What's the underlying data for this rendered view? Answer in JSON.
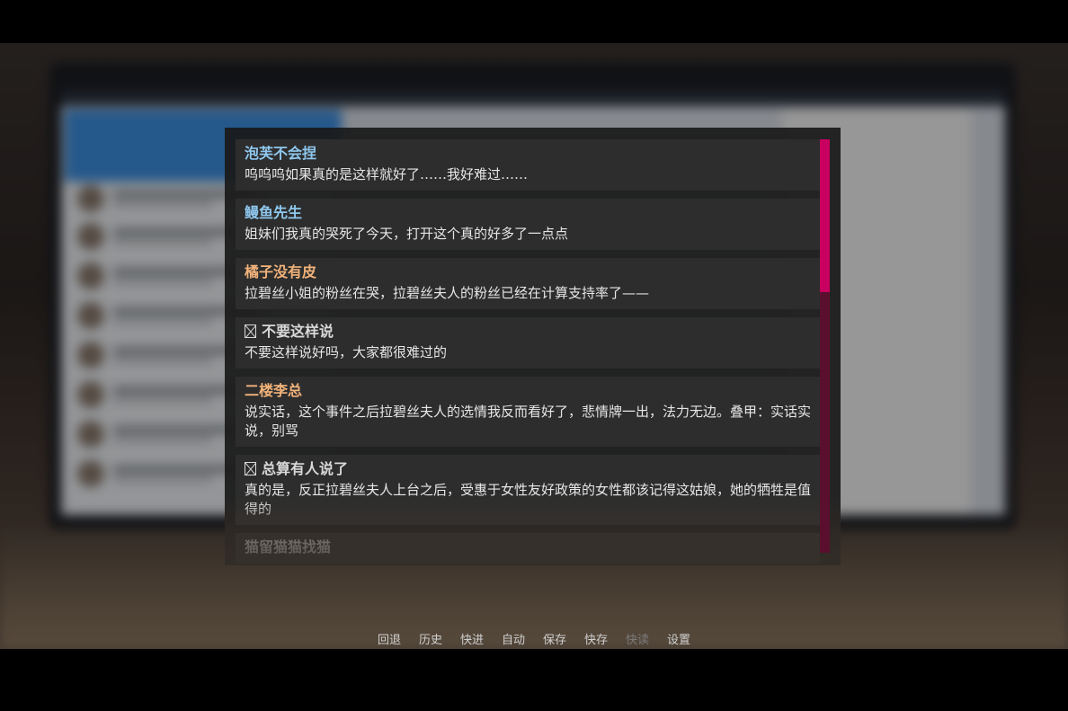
{
  "history": {
    "entries": [
      {
        "who": "泡芙不会捏",
        "what": "呜呜呜如果真的是这样就好了……我好难过……",
        "style": "blue",
        "marker": false
      },
      {
        "who": "鳗鱼先生",
        "what": "姐妹们我真的哭死了今天，打开这个真的好多了一点点",
        "style": "blue",
        "marker": false
      },
      {
        "who": "橘子没有皮",
        "what": "拉碧丝小姐的粉丝在哭，拉碧丝夫人的粉丝已经在计算支持率了——",
        "style": "orange",
        "marker": false
      },
      {
        "who": "不要这样说",
        "what": "不要这样说好吗，大家都很难过的",
        "style": "gray",
        "marker": true
      },
      {
        "who": "二楼李总",
        "what": "说实话，这个事件之后拉碧丝夫人的选情我反而看好了，悲情牌一出，法力无边。叠甲：实话实说，别骂",
        "style": "orange",
        "marker": false
      },
      {
        "who": "总算有人说了",
        "what": "真的是，反正拉碧丝夫人上台之后，受惠于女性友好政策的女性都该记得这姑娘，她的牺牲是值得的",
        "style": "gray",
        "marker": true
      },
      {
        "who": "猫留猫猫找猫",
        "what": "",
        "style": "gray",
        "marker": false
      }
    ],
    "scroll_position": 0.0,
    "scroll_visible_fraction": 0.37,
    "colors": {
      "name_blue": "#8fc8ee",
      "name_orange": "#f1b27a",
      "scrollbar_thumb": "#c8005f",
      "scrollbar_track": "#5a0f2e"
    }
  },
  "quick_menu": {
    "back": "回退",
    "history": "历史",
    "skip": "快进",
    "auto": "自动",
    "save": "保存",
    "quick_save": "快存",
    "quick_load": "快读",
    "preferences": "设置"
  }
}
